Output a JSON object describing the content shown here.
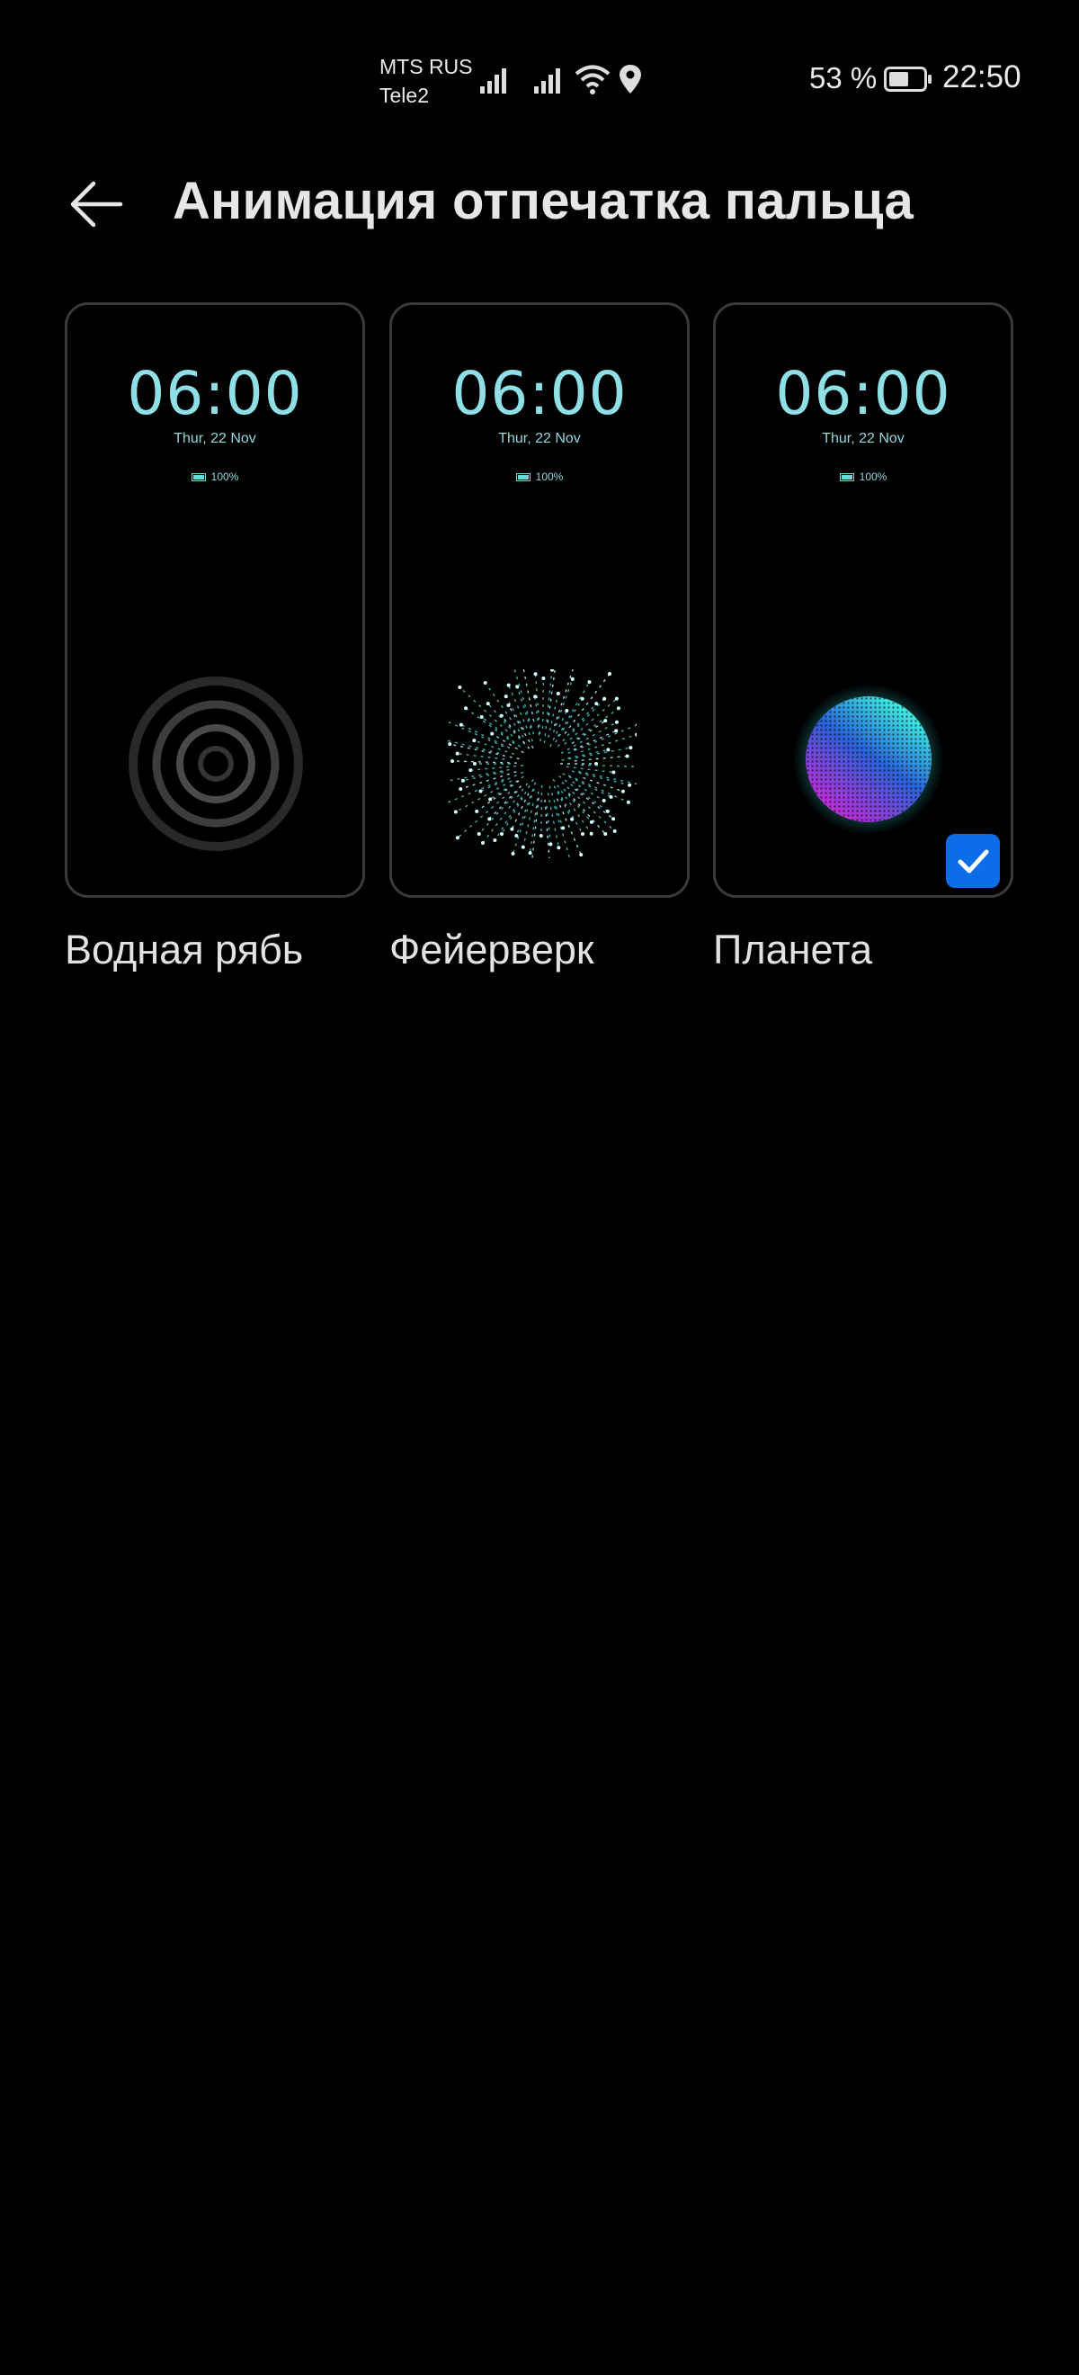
{
  "status_bar": {
    "carrier_1": "MTS RUS",
    "carrier_2": "Tele2",
    "battery_percent": "53 %",
    "time": "22:50"
  },
  "header": {
    "title": "Анимация отпечатка пальца",
    "back_icon": "arrow-left-icon"
  },
  "preview": {
    "time": "06:00",
    "date": "Thur, 22 Nov",
    "battery": "100%"
  },
  "options": [
    {
      "label": "Водная рябь",
      "animation": "ripple",
      "selected": false
    },
    {
      "label": "Фейерверк",
      "animation": "firework",
      "selected": false
    },
    {
      "label": "Планета",
      "animation": "planet",
      "selected": true
    }
  ],
  "colors": {
    "background": "#000000",
    "preview_text": "#8fe0e6",
    "accent": "#0b6de8"
  }
}
